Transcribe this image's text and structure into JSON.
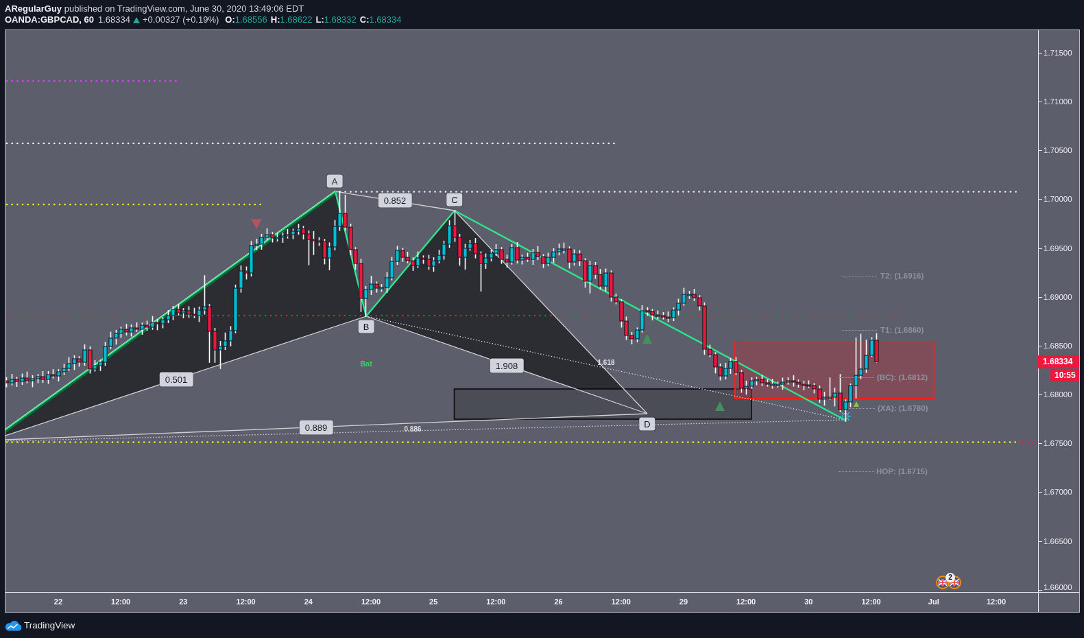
{
  "header": {
    "byline": "**ARegularGuy** published on TradingView.com, June 30, 2020 13:49:06 EDT",
    "symbol": "OANDA:GBPCAD, 60",
    "last": "1.68334",
    "rising": true,
    "change": "+0.00327 (+0.19%)",
    "ohlc": [
      {
        "label": "O:",
        "value": "1.68556"
      },
      {
        "label": "H:",
        "value": "1.68622"
      },
      {
        "label": "L:",
        "value": "1.68332"
      },
      {
        "label": "C:",
        "value": "1.68334"
      }
    ]
  },
  "chart": {
    "chart_data": {
      "type": "candlestick",
      "categories": [
        null,
        null,
        null,
        null,
        null,
        null,
        null,
        null,
        null,
        null,
        "22",
        null,
        null,
        null,
        null,
        null,
        null,
        null,
        null,
        null,
        null,
        null,
        "12:00",
        null,
        null,
        null,
        null,
        null,
        null,
        null,
        null,
        null,
        null,
        null,
        "23",
        null,
        null,
        null,
        null,
        null,
        null,
        null,
        null,
        null,
        null,
        null,
        "12:00",
        null,
        null,
        null,
        null,
        null,
        null,
        null,
        null,
        null,
        null,
        null,
        "24",
        null,
        null,
        null,
        null,
        null,
        null,
        null,
        null,
        null,
        null,
        null,
        "12:00",
        null,
        null,
        null,
        null,
        null,
        null,
        null,
        null,
        null,
        null,
        null,
        "25",
        null,
        null,
        null,
        null,
        null,
        null,
        null,
        null,
        null,
        null,
        null,
        "12:00",
        null,
        null,
        null,
        null,
        null,
        null,
        null,
        null,
        null,
        null,
        null,
        "26",
        null,
        null,
        null,
        null,
        null,
        null,
        null,
        null,
        null,
        null,
        null,
        "12:00",
        null,
        null,
        null,
        null,
        null,
        null,
        null,
        null,
        null,
        null,
        null,
        "29",
        null,
        null,
        null,
        null,
        null,
        null,
        null,
        null,
        null,
        null,
        null,
        "12:00",
        null,
        null,
        null,
        null,
        null,
        null,
        null,
        null,
        null,
        null,
        null,
        "30",
        null,
        null,
        null,
        null,
        null,
        null,
        null,
        null,
        null,
        null,
        null,
        "12:00",
        null,
        null,
        null,
        null,
        null,
        null,
        null,
        null,
        null,
        null,
        null,
        "Jul",
        null,
        null,
        null,
        null,
        null,
        null,
        null,
        null,
        null,
        null,
        null,
        "12:00",
        null,
        null,
        null,
        null,
        null,
        null,
        null,
        null
      ],
      "ohlc": [
        [
          1.68141,
          1.68171,
          1.6808,
          1.6812
        ],
        [
          1.6812,
          1.68205,
          1.681,
          1.68155
        ],
        [
          1.68155,
          1.68175,
          1.68084,
          1.68134
        ],
        [
          1.68134,
          1.68209,
          1.68104,
          1.68169
        ],
        [
          1.68169,
          1.68229,
          1.68121,
          1.68141
        ],
        [
          1.68141,
          1.68192,
          1.68081,
          1.68162
        ],
        [
          1.68162,
          1.68203,
          1.68122,
          1.68183
        ],
        [
          1.68183,
          1.68233,
          1.68125,
          1.68155
        ],
        [
          1.68155,
          1.68234,
          1.68115,
          1.68204
        ],
        [
          1.68204,
          1.68254,
          1.6817,
          1.6819
        ],
        [
          1.6819,
          1.68253,
          1.6814,
          1.68233
        ],
        [
          1.68233,
          1.68308,
          1.68203,
          1.68268
        ],
        [
          1.68268,
          1.68377,
          1.68248,
          1.68317
        ],
        [
          1.68317,
          1.68396,
          1.68257,
          1.68366
        ],
        [
          1.68366,
          1.68386,
          1.68291,
          1.68331
        ],
        [
          1.68331,
          1.68507,
          1.68301,
          1.68457
        ],
        [
          1.68457,
          1.68487,
          1.68221,
          1.68261
        ],
        [
          1.68261,
          1.68346,
          1.68241,
          1.68296
        ],
        [
          1.68296,
          1.68351,
          1.68246,
          1.68331
        ],
        [
          1.68331,
          1.68532,
          1.68301,
          1.68492
        ],
        [
          1.68492,
          1.68637,
          1.68472,
          1.68577
        ],
        [
          1.68577,
          1.68656,
          1.68517,
          1.68626
        ],
        [
          1.68626,
          1.68688,
          1.68586,
          1.68668
        ],
        [
          1.68668,
          1.68718,
          1.6861,
          1.6864
        ],
        [
          1.6864,
          1.68712,
          1.686,
          1.68682
        ],
        [
          1.68682,
          1.68732,
          1.68648,
          1.68668
        ],
        [
          1.68668,
          1.6873,
          1.68618,
          1.6871
        ],
        [
          1.6871,
          1.6875,
          1.68659,
          1.68689
        ],
        [
          1.68689,
          1.68798,
          1.68669,
          1.68738
        ],
        [
          1.68738,
          1.68768,
          1.68664,
          1.68724
        ],
        [
          1.68724,
          1.68786,
          1.68684,
          1.68766
        ],
        [
          1.68766,
          1.68858,
          1.68736,
          1.68808
        ],
        [
          1.68808,
          1.68902,
          1.68768,
          1.68872
        ],
        [
          1.68872,
          1.68922,
          1.68816,
          1.68836
        ],
        [
          1.68836,
          1.68878,
          1.68786,
          1.68858
        ],
        [
          1.68858,
          1.68898,
          1.68792,
          1.68822
        ],
        [
          1.68822,
          1.68882,
          1.68788,
          1.68808
        ],
        [
          1.68808,
          1.68895,
          1.68748,
          1.68865
        ],
        [
          1.68865,
          1.69216,
          1.68825,
          1.689
        ],
        [
          1.689,
          1.6892,
          1.68331,
          1.68647
        ],
        [
          1.68647,
          1.68677,
          1.68331,
          1.68457
        ],
        [
          1.68457,
          1.68542,
          1.68268,
          1.68492
        ],
        [
          1.68492,
          1.68629,
          1.68462,
          1.68549
        ],
        [
          1.68549,
          1.68694,
          1.68499,
          1.68654
        ],
        [
          1.68654,
          1.69119,
          1.68634,
          1.69089
        ],
        [
          1.69089,
          1.69315,
          1.69049,
          1.69265
        ],
        [
          1.69265,
          1.69305,
          1.69184,
          1.69244
        ],
        [
          1.69244,
          1.69565,
          1.69214,
          1.69525
        ],
        [
          1.69525,
          1.69589,
          1.69485,
          1.69539
        ],
        [
          1.69539,
          1.69639,
          1.69489,
          1.69609
        ],
        [
          1.69609,
          1.69697,
          1.69589,
          1.69637
        ],
        [
          1.69637,
          1.69657,
          1.69562,
          1.69602
        ],
        [
          1.69602,
          1.69649,
          1.69572,
          1.69609
        ],
        [
          1.69609,
          1.69653,
          1.69559,
          1.69623
        ],
        [
          1.69623,
          1.69687,
          1.69603,
          1.69637
        ],
        [
          1.69637,
          1.69692,
          1.69597,
          1.69672
        ],
        [
          1.69672,
          1.6974,
          1.69642,
          1.697
        ],
        [
          1.697,
          1.6972,
          1.69594,
          1.69644
        ],
        [
          1.69644,
          1.69674,
          1.6933,
          1.69588
        ],
        [
          1.69588,
          1.69668,
          1.69434,
          1.69574
        ],
        [
          1.69574,
          1.69604,
          1.69527,
          1.69567
        ],
        [
          1.69567,
          1.69587,
          1.69338,
          1.69398
        ],
        [
          1.69398,
          1.69551,
          1.69278,
          1.69511
        ],
        [
          1.69511,
          1.69781,
          1.69481,
          1.69721
        ],
        [
          1.69721,
          1.70079,
          1.69681,
          1.69855
        ],
        [
          1.69855,
          1.7004,
          1.69684,
          1.69714
        ],
        [
          1.69714,
          1.69744,
          1.69433,
          1.69483
        ],
        [
          1.69483,
          1.69503,
          1.69282,
          1.69342
        ],
        [
          1.69342,
          1.69382,
          1.68851,
          1.68984
        ],
        [
          1.68984,
          1.69105,
          1.68801,
          1.69075
        ],
        [
          1.69075,
          1.69211,
          1.69025,
          1.69131
        ],
        [
          1.69131,
          1.69151,
          1.69049,
          1.69089
        ],
        [
          1.69089,
          1.69126,
          1.69059,
          1.69096
        ],
        [
          1.69096,
          1.69245,
          1.69046,
          1.69195
        ],
        [
          1.69195,
          1.69403,
          1.69175,
          1.69363
        ],
        [
          1.69363,
          1.69516,
          1.69333,
          1.69476
        ],
        [
          1.69476,
          1.69496,
          1.69365,
          1.69405
        ],
        [
          1.69405,
          1.69455,
          1.6935,
          1.6937
        ],
        [
          1.6937,
          1.694,
          1.69271,
          1.69321
        ],
        [
          1.69321,
          1.69458,
          1.69301,
          1.69398
        ],
        [
          1.69398,
          1.69418,
          1.69344,
          1.69384
        ],
        [
          1.69384,
          1.69424,
          1.69284,
          1.69314
        ],
        [
          1.69314,
          1.694,
          1.69264,
          1.6937
        ],
        [
          1.6937,
          1.69476,
          1.6935,
          1.69426
        ],
        [
          1.69426,
          1.69569,
          1.69386,
          1.69539
        ],
        [
          1.69539,
          1.69778,
          1.69509,
          1.69728
        ],
        [
          1.69728,
          1.69883,
          1.69569,
          1.69609
        ],
        [
          1.69609,
          1.69639,
          1.69325,
          1.69405
        ],
        [
          1.69405,
          1.69537,
          1.69285,
          1.69497
        ],
        [
          1.69497,
          1.69576,
          1.69477,
          1.69546
        ],
        [
          1.69546,
          1.69596,
          1.694,
          1.6944
        ],
        [
          1.6944,
          1.6946,
          1.69061,
          1.69342
        ],
        [
          1.69342,
          1.69438,
          1.69292,
          1.69398
        ],
        [
          1.69398,
          1.69477,
          1.69368,
          1.69447
        ],
        [
          1.69447,
          1.69533,
          1.69427,
          1.69483
        ],
        [
          1.69483,
          1.69503,
          1.69344,
          1.69384
        ],
        [
          1.69384,
          1.69424,
          1.69306,
          1.69356
        ],
        [
          1.69356,
          1.69534,
          1.69336,
          1.69504
        ],
        [
          1.69504,
          1.69554,
          1.69347,
          1.69377
        ],
        [
          1.69377,
          1.69425,
          1.69337,
          1.69405
        ],
        [
          1.69405,
          1.69445,
          1.69364,
          1.69384
        ],
        [
          1.69384,
          1.69484,
          1.69334,
          1.69454
        ],
        [
          1.69454,
          1.69514,
          1.69382,
          1.69412
        ],
        [
          1.69412,
          1.69432,
          1.69302,
          1.69342
        ],
        [
          1.69342,
          1.69445,
          1.69322,
          1.69405
        ],
        [
          1.69405,
          1.69491,
          1.69355,
          1.69461
        ],
        [
          1.69461,
          1.6954,
          1.69431,
          1.6949
        ],
        [
          1.6949,
          1.6955,
          1.6945,
          1.6949
        ],
        [
          1.6949,
          1.6951,
          1.69296,
          1.69356
        ],
        [
          1.69356,
          1.6948,
          1.69326,
          1.6944
        ],
        [
          1.6944,
          1.6947,
          1.6932,
          1.6937
        ],
        [
          1.6937,
          1.6939,
          1.691,
          1.6916
        ],
        [
          1.6916,
          1.69361,
          1.6904,
          1.69321
        ],
        [
          1.69321,
          1.69351,
          1.6919,
          1.6923
        ],
        [
          1.6923,
          1.6928,
          1.6908,
          1.6911
        ],
        [
          1.6911,
          1.69284,
          1.6906,
          1.69244
        ],
        [
          1.69244,
          1.69264,
          1.68958,
          1.68998
        ],
        [
          1.68998,
          1.69028,
          1.68929,
          1.68949
        ],
        [
          1.68949,
          1.68969,
          1.68692,
          1.68752
        ],
        [
          1.68752,
          1.68792,
          1.68565,
          1.68605
        ],
        [
          1.68605,
          1.68635,
          1.6852,
          1.6857
        ],
        [
          1.6857,
          1.68681,
          1.6854,
          1.68661
        ],
        [
          1.68661,
          1.68908,
          1.68641,
          1.68858
        ],
        [
          1.68858,
          1.68888,
          1.68811,
          1.68851
        ],
        [
          1.68851,
          1.68871,
          1.68765,
          1.68815
        ],
        [
          1.68815,
          1.68855,
          1.68778,
          1.68808
        ],
        [
          1.68808,
          1.68838,
          1.68774,
          1.68794
        ],
        [
          1.68794,
          1.68844,
          1.68747,
          1.68787
        ],
        [
          1.68787,
          1.68885,
          1.68757,
          1.68865
        ],
        [
          1.68865,
          1.68975,
          1.68815,
          1.68935
        ],
        [
          1.68935,
          1.69086,
          1.68915,
          1.69026
        ],
        [
          1.69026,
          1.69056,
          1.68986,
          1.69026
        ],
        [
          1.69026,
          1.69076,
          1.68961,
          1.68991
        ],
        [
          1.68991,
          1.69011,
          1.68867,
          1.68907
        ],
        [
          1.68907,
          1.68937,
          1.68414,
          1.68464
        ],
        [
          1.68464,
          1.68504,
          1.68388,
          1.68408
        ],
        [
          1.68408,
          1.68428,
          1.68222,
          1.68282
        ],
        [
          1.68282,
          1.68312,
          1.6815,
          1.6819
        ],
        [
          1.6819,
          1.68318,
          1.6816,
          1.68268
        ],
        [
          1.68268,
          1.68368,
          1.68218,
          1.68338
        ],
        [
          1.68338,
          1.68378,
          1.68206,
          1.68226
        ],
        [
          1.68226,
          1.68246,
          1.68024,
          1.68064
        ],
        [
          1.68064,
          1.68135,
          1.68004,
          1.68085
        ],
        [
          1.68085,
          1.68171,
          1.68065,
          1.68141
        ],
        [
          1.68141,
          1.68175,
          1.68101,
          1.68155
        ],
        [
          1.68155,
          1.68195,
          1.6809,
          1.6812
        ],
        [
          1.6812,
          1.6815,
          1.68086,
          1.68106
        ],
        [
          1.68106,
          1.68156,
          1.68066,
          1.68106
        ],
        [
          1.68106,
          1.68126,
          1.68076,
          1.68106
        ],
        [
          1.68106,
          1.68167,
          1.68056,
          1.68127
        ],
        [
          1.68127,
          1.68171,
          1.68107,
          1.68141
        ],
        [
          1.68141,
          1.68191,
          1.68087,
          1.68127
        ],
        [
          1.68127,
          1.68147,
          1.68076,
          1.68106
        ],
        [
          1.68106,
          1.68136,
          1.68049,
          1.68099
        ],
        [
          1.68099,
          1.68139,
          1.68072,
          1.68092
        ],
        [
          1.68092,
          1.68112,
          1.68017,
          1.68057
        ],
        [
          1.68057,
          1.68087,
          1.67922,
          1.67952
        ],
        [
          1.67952,
          1.68023,
          1.67892,
          1.67973
        ],
        [
          1.67973,
          1.68169,
          1.67953,
          1.67973
        ],
        [
          1.67973,
          1.68065,
          1.67884,
          1.68015
        ],
        [
          1.68015,
          1.68204,
          1.67826,
          1.67846
        ],
        [
          1.67846,
          1.67944,
          1.67727,
          1.67924
        ],
        [
          1.67924,
          1.68106,
          1.67877,
          1.68092
        ],
        [
          1.68092,
          1.68579,
          1.67966,
          1.68197
        ],
        [
          1.68197,
          1.68617,
          1.68165,
          1.68261
        ],
        [
          1.68261,
          1.68556,
          1.68228,
          1.68401
        ],
        [
          1.68401,
          1.6858,
          1.6839,
          1.68556
        ],
        [
          1.68556,
          1.68622,
          1.68332,
          1.68334
        ],
        null,
        null,
        null,
        null,
        null,
        null,
        null,
        null,
        null,
        null,
        null,
        null,
        null,
        null,
        null,
        null,
        null,
        null,
        null,
        null,
        null,
        null,
        null,
        null,
        null,
        null,
        null,
        null,
        null,
        null,
        null
      ],
      "ylim": [
        1.65978,
        1.7173
      ],
      "yticks": [
        {
          "value": 1.715,
          "label": "1.71500"
        },
        {
          "value": 1.71,
          "label": "1.71000"
        },
        {
          "value": 1.705,
          "label": "1.70500"
        },
        {
          "value": 1.7,
          "label": "1.70000"
        },
        {
          "value": 1.695,
          "label": "1.69500"
        },
        {
          "value": 1.69,
          "label": "1.69000"
        },
        {
          "value": 1.685,
          "label": "1.68500"
        },
        {
          "value": 1.68,
          "label": "1.68000"
        },
        {
          "value": 1.675,
          "label": "1.67500"
        },
        {
          "value": 1.67,
          "label": "1.67000"
        },
        {
          "value": 1.665,
          "label": "1.66500"
        },
        {
          "value": 1.66,
          "label": "1.66000"
        }
      ]
    },
    "pattern": {
      "name": "Bat",
      "points": [
        "A",
        "B",
        "C",
        "D"
      ],
      "ratios": [
        "0.501",
        "0.852",
        "1.908",
        "0.889"
      ],
      "projections": [
        "0.886",
        "1.618"
      ]
    },
    "targets": [
      "T2: (1.6916)",
      "T1: (1.6860)",
      "(BC): (1.6812)",
      "(XA): (1.6780)",
      "HOP: (1.6715)"
    ],
    "events": {
      "count": "2"
    }
  },
  "price_axis": {
    "last_price": "1.68334",
    "countdown": "10:55"
  },
  "footer": {
    "brand": "TradingView"
  }
}
